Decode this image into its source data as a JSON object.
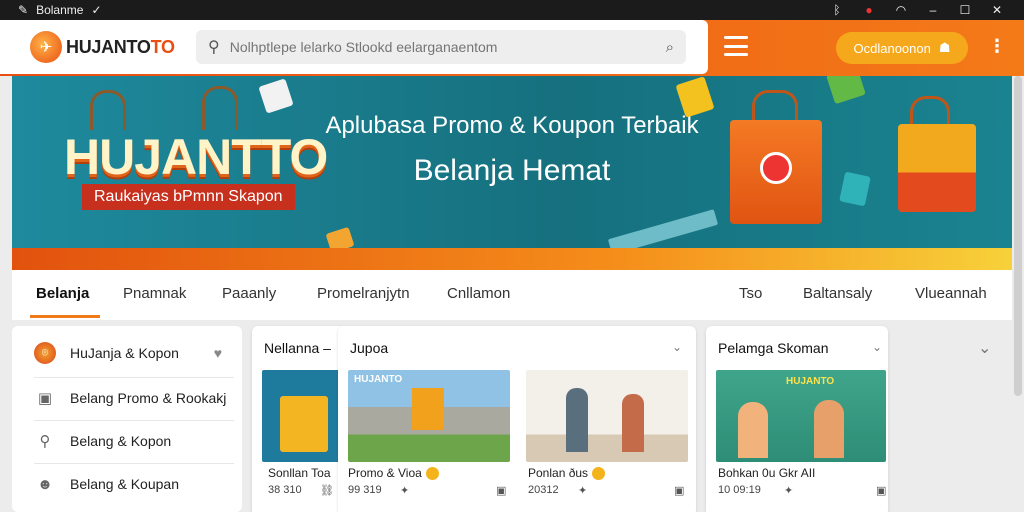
{
  "os_bar": {
    "app_name": "Bolanme",
    "app_caret": "✓"
  },
  "header": {
    "logo": {
      "text_main": "HUJANTO",
      "text_accent": "TO"
    },
    "search": {
      "placeholder": "Nolhptlepe lelarko Stlookd eelarganaentom"
    },
    "cta_label": "Ocdlanoonon"
  },
  "hero": {
    "brand": "HUJANTTO",
    "subtitle": "Raukaiyas bPmnn Skapon",
    "headline": "Aplubasa Promo & Koupon Terbaik",
    "headline2": "Belanja Hemat"
  },
  "tabs": [
    {
      "label": "Belanja",
      "active": true
    },
    {
      "label": "Pnamnak"
    },
    {
      "label": "Paaanly"
    },
    {
      "label": "Promelranjytn"
    },
    {
      "label": "Cnllamon"
    },
    {
      "label": "Tso"
    },
    {
      "label": "Baltansaly"
    },
    {
      "label": "Vlueannah"
    }
  ],
  "sidebar": {
    "items": [
      {
        "label": "HuJanja & Kopon",
        "icon": "brand-logo-icon",
        "badge": "heart-icon"
      },
      {
        "label": "Belang Promo & Rookakj",
        "icon": "tag-icon"
      },
      {
        "label": "Belang & Kopon",
        "icon": "search-icon"
      },
      {
        "label": "Belang & Koupan",
        "icon": "user-icon"
      }
    ]
  },
  "cards": [
    {
      "header": "Nellanna –",
      "caption": "Sonllan Toa",
      "meta": "38 310",
      "meta_icon": "⛓"
    },
    {
      "header": "Jupoa",
      "thumb_label": "HUJANTO",
      "caption": "Promo & Vioa",
      "meta": "99 319",
      "meta_icon": "✦",
      "meta_right": "▣"
    },
    {
      "caption": "Ponlan ðus",
      "meta": "20312",
      "meta_icon": "✦",
      "meta_right": "▣"
    },
    {
      "header": "Pelamga Skoman",
      "thumb_label": "HUJANTO",
      "caption": "Bohkan 0u Gkr AII",
      "meta": "10 09:19",
      "meta_icon": "✦",
      "meta_right": "▣"
    }
  ]
}
